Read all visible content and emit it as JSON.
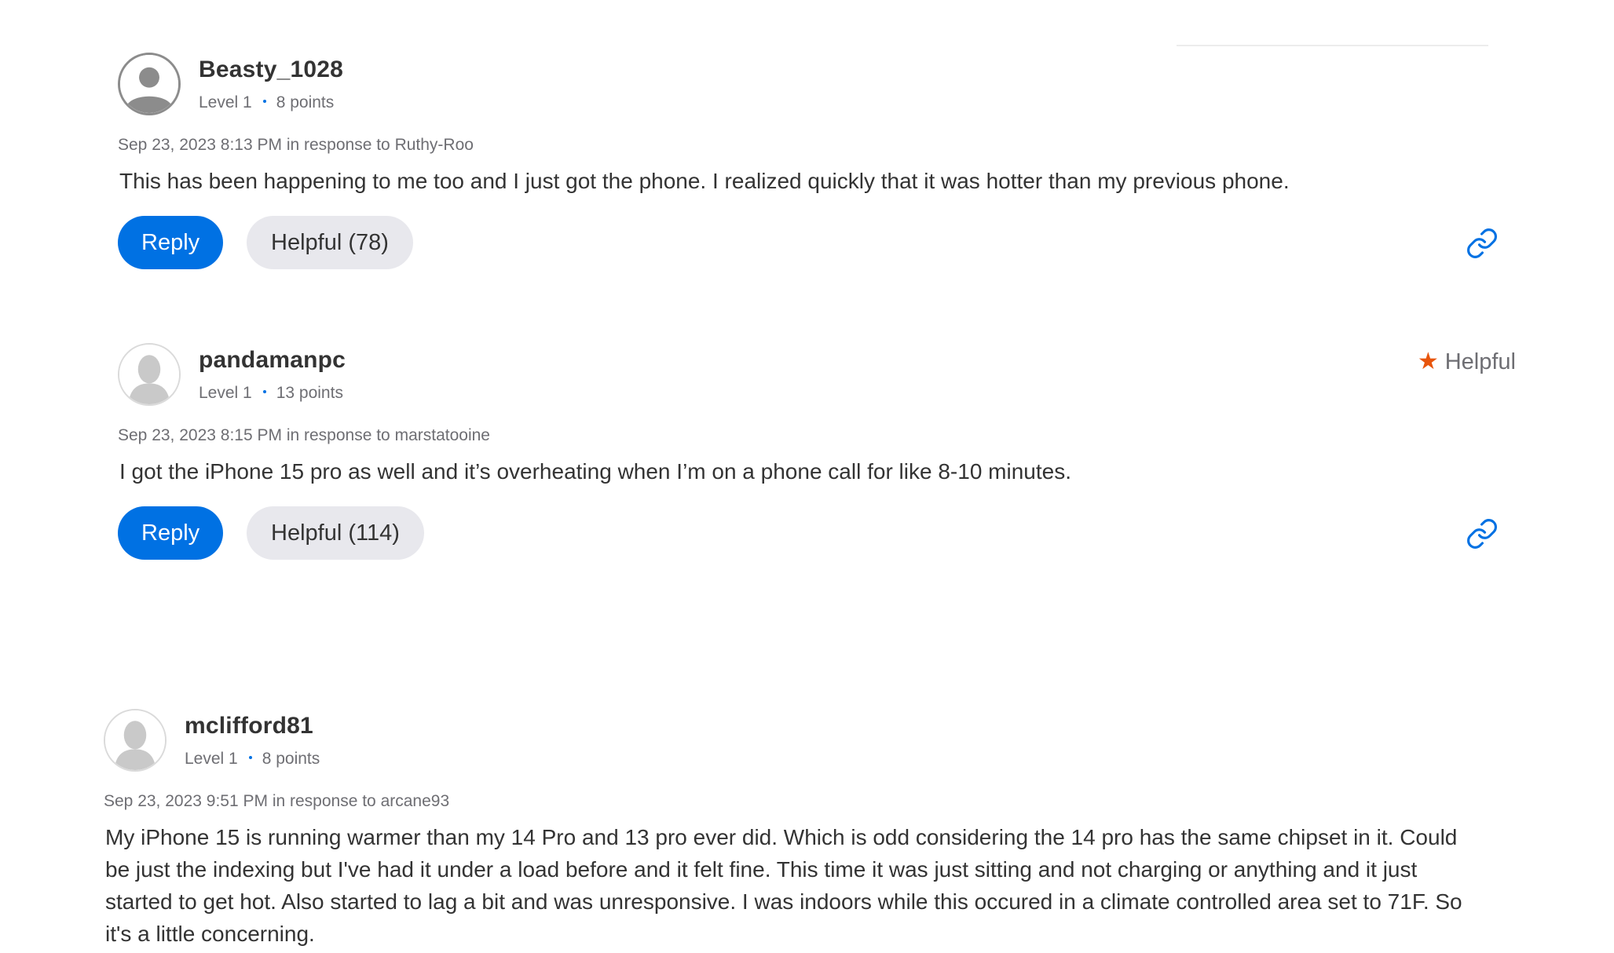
{
  "icons": {
    "avatar_default": "person-silhouette-icon",
    "avatar_photo": "person-photo-icon",
    "link": "link-icon",
    "star": "star-icon"
  },
  "colors": {
    "accent": "#0071e3",
    "star": "#e8550c",
    "helpful_bg": "#e8e8ed"
  },
  "posts": [
    {
      "username": "Beasty_1028",
      "level": "Level 1",
      "points": "8 points",
      "timestamp": "Sep 23, 2023 8:13 PM in response to Ruthy-Roo",
      "body": "This has been happening to me too and I just got the phone. I realized quickly that it was hotter than my previous phone.",
      "reply_label": "Reply",
      "helpful_label": "Helpful (78)"
    },
    {
      "username": "pandamanpc",
      "level": "Level 1",
      "points": "13 points",
      "helpful_badge": "Helpful",
      "timestamp": "Sep 23, 2023 8:15 PM in response to marstatooine",
      "body": "I got the iPhone 15 pro as well and it’s overheating when I’m on a phone call for like 8-10 minutes.",
      "reply_label": "Reply",
      "helpful_label": "Helpful (114)"
    },
    {
      "username": "mclifford81",
      "level": "Level 1",
      "points": "8 points",
      "timestamp": "Sep 23, 2023 9:51 PM in response to arcane93",
      "body": "My iPhone 15 is running warmer than my 14 Pro and 13 pro ever did. Which is odd considering the 14 pro has the same chipset in it. Could be just the indexing but I've had it under a load before and it felt fine. This time it was just sitting and not charging or anything and it just started to get hot. Also started to lag a bit and was unresponsive. I was indoors while this occured in a climate controlled area set to 71F. So it's a little concerning."
    }
  ]
}
